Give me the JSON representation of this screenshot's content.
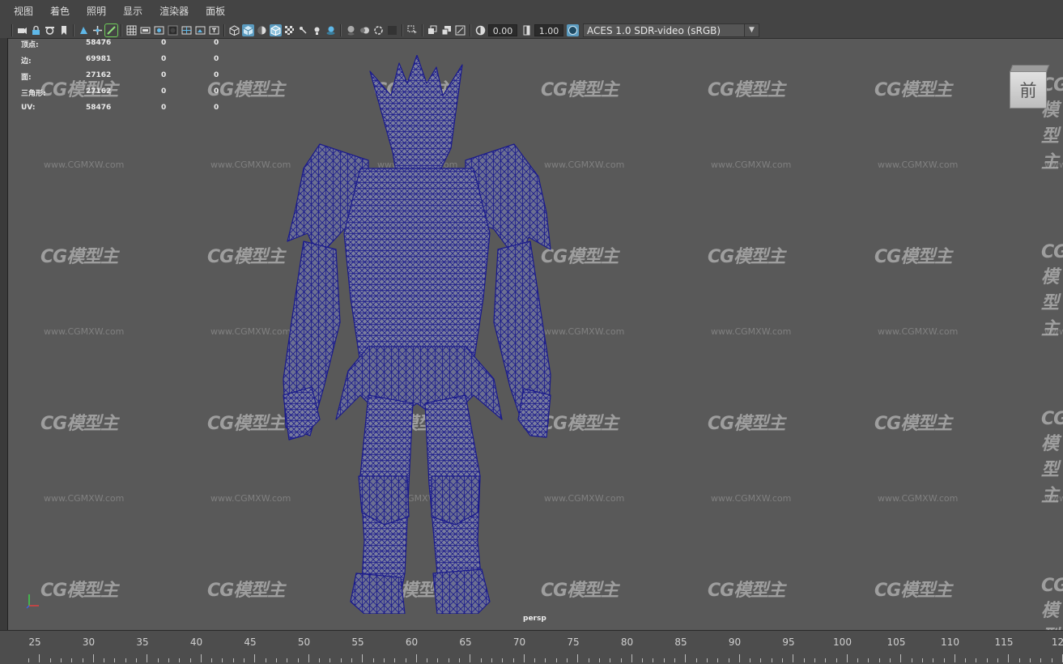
{
  "menu": [
    "视图",
    "着色",
    "照明",
    "显示",
    "渲染器",
    "面板"
  ],
  "toolbar": {
    "exposure_value": "0.00",
    "gamma_value": "1.00",
    "color_management": "ACES 1.0 SDR-video (sRGB)",
    "icons": [
      "camera-select-icon",
      "camera-lock-icon",
      "camera-attributes-icon",
      "bookmark-icon",
      "image-plane-icon",
      "2d-pan-zoom-icon",
      "grease-pencil-icon",
      "grid-icon",
      "film-gate-icon",
      "resolution-gate-icon",
      "gate-mask-icon",
      "field-chart-icon",
      "safe-action-icon",
      "safe-title-icon",
      "wireframe-icon",
      "smooth-shade-icon",
      "default-material-icon",
      "wireframe-on-shaded-icon",
      "xray-icon",
      "xray-joints-icon",
      "use-all-lights-icon",
      "shadows-icon",
      "screen-space-ao-icon",
      "motion-blur-icon",
      "anti-alias-icon",
      "depth-of-field-icon",
      "isolate-select-icon",
      "hud-icon",
      "xray-active-icon",
      "textured-icon",
      "exposure-icon",
      "gamma-icon",
      "color-management-icon"
    ]
  },
  "hud": [
    {
      "label": "顶点:",
      "v1": "58476",
      "v2": "0",
      "v3": "0"
    },
    {
      "label": "边:",
      "v1": "69981",
      "v2": "0",
      "v3": "0"
    },
    {
      "label": "面:",
      "v1": "27162",
      "v2": "0",
      "v3": "0"
    },
    {
      "label": "三角形:",
      "v1": "27162",
      "v2": "0",
      "v3": "0"
    },
    {
      "label": "UV:",
      "v1": "58476",
      "v2": "0",
      "v3": "0"
    }
  ],
  "viewport": {
    "camera_label": "persp",
    "viewcube_face": "前",
    "wireframe_color": "#1a1a8c",
    "background_color": "#595959"
  },
  "watermark": {
    "logo": "CG模型主",
    "url": "www.CGMXW.com"
  },
  "timeline": {
    "ticks": [
      "25",
      "30",
      "35",
      "40",
      "45",
      "50",
      "55",
      "60",
      "65",
      "70",
      "75",
      "80",
      "85",
      "90",
      "95",
      "100",
      "105",
      "110",
      "115",
      "12"
    ]
  }
}
